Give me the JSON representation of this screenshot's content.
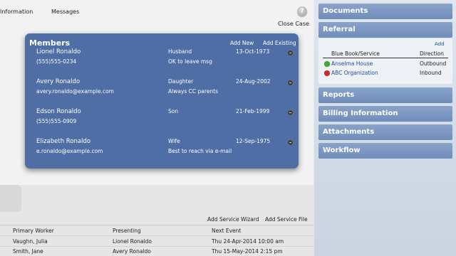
{
  "tabs": {
    "information": "Information",
    "messages": "Messages"
  },
  "help": {
    "glyph": "?"
  },
  "close_case": "Close Case",
  "members": {
    "title": "Members",
    "add_new": "Add New",
    "add_existing": "Add Existing",
    "rows": [
      {
        "name": "Lionel Ronaldo",
        "contact": "(555)555-0234",
        "relationship": "Husband",
        "note": "OK to leave msg",
        "date": "13-Oct-1973"
      },
      {
        "name": "Avery Ronaldo",
        "contact": "avery.ronaldo@example.com",
        "relationship": "Daughter",
        "note": "Always CC parents",
        "date": "24-Aug-2002"
      },
      {
        "name": "Edson Ronaldo",
        "contact": "(555)555-0909",
        "relationship": "Son",
        "note": "",
        "date": "21-Feb-1999"
      },
      {
        "name": "Elizabeth Ronaldo",
        "contact": "e.ronaldo@example.com",
        "relationship": "Wife",
        "note": "Best to reach via e-mail",
        "date": "12-Sep-1975"
      }
    ]
  },
  "services": {
    "add_wizard": "Add Service Wizard",
    "add_file": "Add Service File",
    "headers": [
      "Primary Worker",
      "Presenting",
      "Next Event"
    ],
    "rows": [
      {
        "worker": "Vaughn, Julia",
        "presenting": "Lionel Ronaldo",
        "next_event": "Thu 24-Apr-2014 10:00 am"
      },
      {
        "worker": "Smith, Jane",
        "presenting": "Avery Ronaldo",
        "next_event": "Thu 15-May-2014 2:15 pm"
      }
    ]
  },
  "sidebar": {
    "sections": [
      "Documents",
      "Referral",
      "Reports",
      "Billing Information",
      "Attachments",
      "Workflow"
    ],
    "referral": {
      "add": "Add",
      "col_service": "Blue Book/Service",
      "col_direction": "Direction",
      "rows": [
        {
          "name": "Anselma House",
          "direction": "Outbound",
          "status_color": "#3fae2a"
        },
        {
          "name": "ABC Organization",
          "direction": "Inbound",
          "status_color": "#d22a2a"
        }
      ]
    }
  },
  "colors": {
    "panel": "#4f6ea6",
    "sidebar_header": "#7b96c1",
    "link": "#1f4fa0"
  }
}
